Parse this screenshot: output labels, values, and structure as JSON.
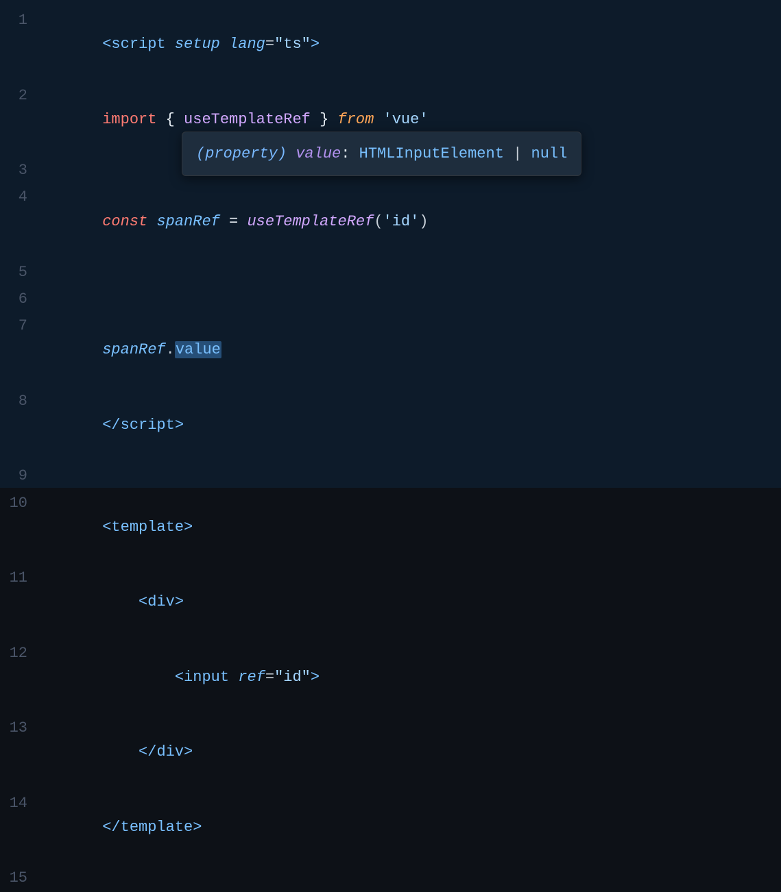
{
  "editor": {
    "background": "#0d1b2a",
    "lines": [
      {
        "number": "1",
        "tokens": [
          {
            "text": "    ",
            "class": ""
          },
          {
            "text": "<",
            "class": "c-tag"
          },
          {
            "text": "script",
            "class": "c-tag"
          },
          {
            "text": " ",
            "class": ""
          },
          {
            "text": "setup",
            "class": "c-attr c-italic"
          },
          {
            "text": " ",
            "class": ""
          },
          {
            "text": "lang",
            "class": "c-attr c-italic"
          },
          {
            "text": "=",
            "class": "c-punctuation"
          },
          {
            "text": "\"ts\"",
            "class": "c-string"
          },
          {
            "text": ">",
            "class": "c-tag"
          }
        ]
      },
      {
        "number": "2",
        "tokens": [
          {
            "text": "    ",
            "class": ""
          },
          {
            "text": "import",
            "class": "c-keyword"
          },
          {
            "text": " { ",
            "class": "c-import-brace"
          },
          {
            "text": "useTemplateRef",
            "class": "c-fn-name"
          },
          {
            "text": " } ",
            "class": "c-import-brace"
          },
          {
            "text": "from",
            "class": "c-from c-italic"
          },
          {
            "text": " ",
            "class": ""
          },
          {
            "text": "'vue'",
            "class": "c-module"
          }
        ]
      },
      {
        "number": "3",
        "tokens": []
      },
      {
        "number": "4",
        "tokens": [
          {
            "text": "    ",
            "class": ""
          },
          {
            "text": "const",
            "class": "c-keyword c-italic"
          },
          {
            "text": " ",
            "class": ""
          },
          {
            "text": "spanRef",
            "class": "c-var c-italic"
          },
          {
            "text": " = ",
            "class": "c-white"
          },
          {
            "text": "useTemplateRef",
            "class": "c-function c-italic"
          },
          {
            "text": "(",
            "class": "c-punctuation"
          },
          {
            "text": "'id'",
            "class": "c-string"
          },
          {
            "text": ")",
            "class": "c-punctuation"
          }
        ]
      },
      {
        "number": "5",
        "tokens": []
      },
      {
        "number": "6",
        "tokens": []
      },
      {
        "number": "7",
        "tokens": [
          {
            "text": "    ",
            "class": ""
          },
          {
            "text": "spanRef",
            "class": "c-var c-italic"
          },
          {
            "text": ".",
            "class": "c-punctuation"
          },
          {
            "text": "value",
            "class": "c-highlight"
          }
        ]
      },
      {
        "number": "8",
        "tokens": [
          {
            "text": "    ",
            "class": ""
          },
          {
            "text": "</",
            "class": "c-tag"
          },
          {
            "text": "script",
            "class": "c-tag"
          },
          {
            "text": ">",
            "class": "c-tag"
          }
        ]
      },
      {
        "number": "9",
        "tokens": []
      },
      {
        "number": "10",
        "tokens": [
          {
            "text": "    ",
            "class": ""
          },
          {
            "text": "<",
            "class": "c-tag"
          },
          {
            "text": "template",
            "class": "c-tag"
          },
          {
            "text": ">",
            "class": "c-tag"
          }
        ]
      },
      {
        "number": "11",
        "tokens": [
          {
            "text": "        ",
            "class": ""
          },
          {
            "text": "<",
            "class": "c-tag"
          },
          {
            "text": "div",
            "class": "c-tag"
          },
          {
            "text": ">",
            "class": "c-tag"
          }
        ]
      },
      {
        "number": "12",
        "tokens": [
          {
            "text": "            ",
            "class": ""
          },
          {
            "text": "<",
            "class": "c-tag"
          },
          {
            "text": "input",
            "class": "c-tag"
          },
          {
            "text": " ",
            "class": ""
          },
          {
            "text": "ref",
            "class": "c-attr c-italic"
          },
          {
            "text": "=",
            "class": "c-punctuation"
          },
          {
            "text": "\"id\"",
            "class": "c-string"
          },
          {
            "text": ">",
            "class": "c-tag"
          }
        ]
      },
      {
        "number": "13",
        "tokens": [
          {
            "text": "        ",
            "class": ""
          },
          {
            "text": "</",
            "class": "c-tag"
          },
          {
            "text": "div",
            "class": "c-tag"
          },
          {
            "text": ">",
            "class": "c-tag"
          }
        ]
      },
      {
        "number": "14",
        "tokens": [
          {
            "text": "    ",
            "class": ""
          },
          {
            "text": "</",
            "class": "c-tag"
          },
          {
            "text": "template",
            "class": "c-tag"
          },
          {
            "text": ">",
            "class": "c-tag"
          }
        ]
      },
      {
        "number": "15",
        "tokens": []
      }
    ],
    "tooltip": {
      "text": "(property) value: HTMLInputElement | null",
      "prefix": "(property) ",
      "value_label": "value",
      "colon": ": ",
      "type1": "HTMLInputElement",
      "pipe": " | ",
      "type2": "null"
    }
  }
}
